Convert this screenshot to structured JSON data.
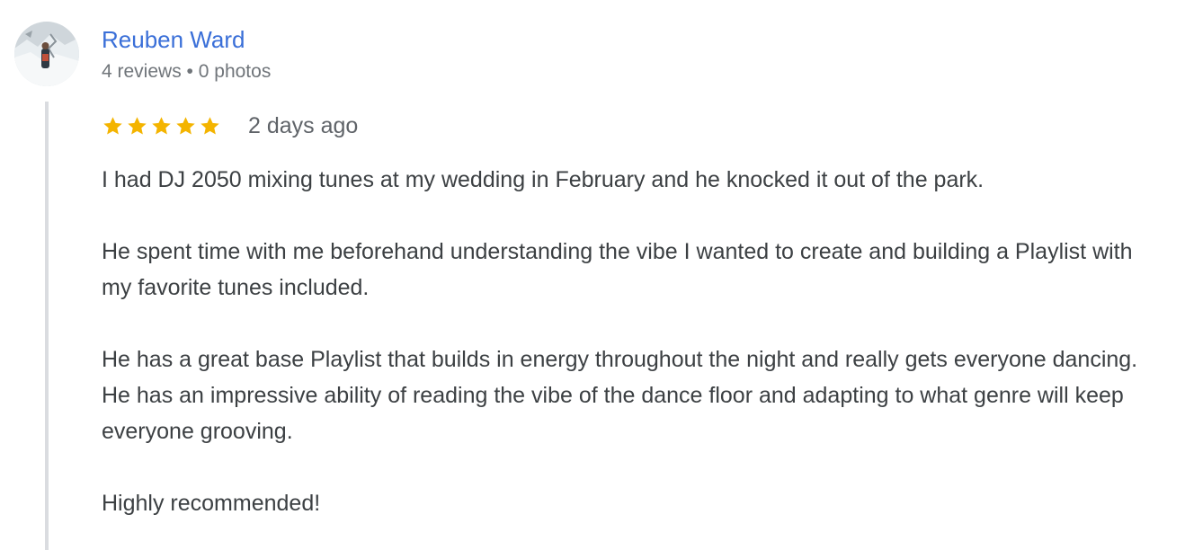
{
  "reviewer": {
    "name": "Reuben Ward",
    "reviews_count": "4 reviews",
    "separator": "•",
    "photos_count": "0 photos",
    "avatar_icon": "avatar-photo-snow-climber"
  },
  "review": {
    "rating": 5,
    "max_rating": 5,
    "star_color": "#f4b400",
    "date": "2 days ago",
    "paragraphs": [
      "I had DJ 2050 mixing tunes at my wedding in February and he knocked it out of the park.",
      "He spent time with me beforehand understanding the vibe I wanted to create and building a Playlist with my favorite tunes included.",
      "He has a great base Playlist that builds in energy throughout the night and really gets everyone dancing. He has an impressive ability of reading the vibe of the dance floor and adapting to what genre will keep everyone grooving.",
      "Highly recommended!"
    ]
  },
  "colors": {
    "name_link": "#3a6fd8",
    "meta_text": "#70757a",
    "body_text": "#3c4043",
    "thread_line": "#dadce0"
  }
}
